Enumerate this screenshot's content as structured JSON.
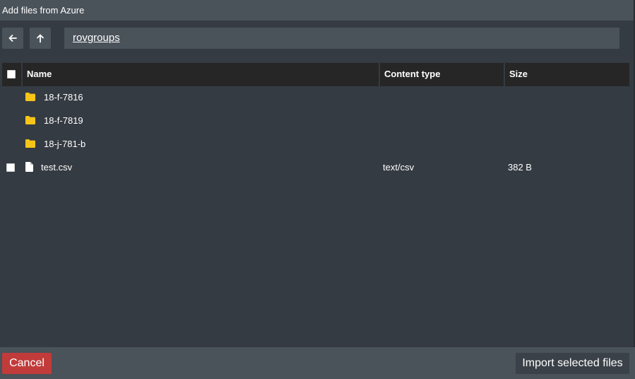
{
  "window": {
    "title": "Add files from Azure"
  },
  "toolbar": {
    "back_icon": "arrow-left-icon",
    "up_icon": "arrow-up-icon",
    "path": "rovgroups"
  },
  "table": {
    "headers": {
      "name": "Name",
      "content_type": "Content type",
      "size": "Size"
    },
    "rows": [
      {
        "type": "folder",
        "icon": "folder-icon",
        "name": "18-f-7816",
        "content_type": "",
        "size": ""
      },
      {
        "type": "folder",
        "icon": "folder-icon",
        "name": "18-f-7819",
        "content_type": "",
        "size": ""
      },
      {
        "type": "folder",
        "icon": "folder-icon",
        "name": "18-j-781-b",
        "content_type": "",
        "size": ""
      },
      {
        "type": "file",
        "icon": "file-icon",
        "name": "test.csv",
        "content_type": "text/csv",
        "size": "382 B"
      }
    ]
  },
  "footer": {
    "cancel_label": "Cancel",
    "import_label": "Import selected files"
  },
  "colors": {
    "background": "#353b42",
    "panel": "#4a525a",
    "header": "#262626",
    "folder": "#f5c518",
    "cancel": "#c23b3b"
  }
}
